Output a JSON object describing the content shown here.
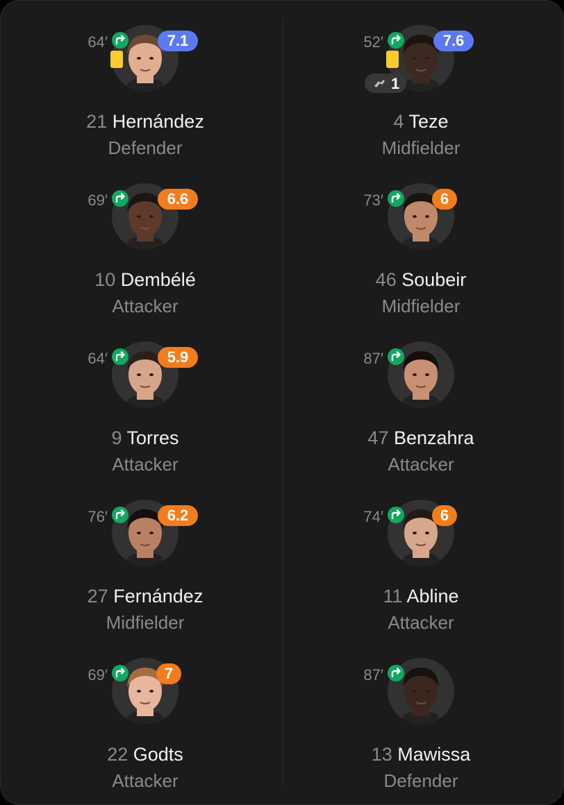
{
  "players": [
    {
      "minute": "64′",
      "rating": "7.1",
      "rating_color": "blue",
      "yellow_card": true,
      "number": "21",
      "name": "Hernández",
      "position": "Defender",
      "skin": "#e2ae92",
      "hair": "#6a4a33"
    },
    {
      "minute": "52′",
      "rating": "7.6",
      "rating_color": "blue",
      "yellow_card": true,
      "goals": "1",
      "number": "4",
      "name": "Teze",
      "position": "Midfielder",
      "skin": "#3c2a22",
      "hair": "#1b1410"
    },
    {
      "minute": "69′",
      "rating": "6.6",
      "rating_color": "orange",
      "number": "10",
      "name": "Dembélé",
      "position": "Attacker",
      "skin": "#5e3a2a",
      "hair": "#1d1612"
    },
    {
      "minute": "73′",
      "rating": "6",
      "rating_color": "orange",
      "number": "46",
      "name": "Soubeir",
      "position": "Midfielder",
      "skin": "#c08a6a",
      "hair": "#1a1410"
    },
    {
      "minute": "64′",
      "rating": "5.9",
      "rating_color": "orange",
      "number": "9",
      "name": "Torres",
      "position": "Attacker",
      "skin": "#d7a58a",
      "hair": "#2b2019"
    },
    {
      "minute": "87′",
      "number": "47",
      "name": "Benzahra",
      "position": "Attacker",
      "skin": "#c99073",
      "hair": "#140f0c"
    },
    {
      "minute": "76′",
      "rating": "6.2",
      "rating_color": "orange",
      "number": "27",
      "name": "Fernández",
      "position": "Midfielder",
      "skin": "#b98063",
      "hair": "#14100d"
    },
    {
      "minute": "74′",
      "rating": "6",
      "rating_color": "orange",
      "number": "11",
      "name": "Abline",
      "position": "Attacker",
      "skin": "#d8a68b",
      "hair": "#241a14"
    },
    {
      "minute": "69′",
      "rating": "7",
      "rating_color": "orange",
      "number": "22",
      "name": "Godts",
      "position": "Attacker",
      "skin": "#e8b69c",
      "hair": "#a56d3f"
    },
    {
      "minute": "87′",
      "number": "13",
      "name": "Mawissa",
      "position": "Defender",
      "skin": "#3b2720",
      "hair": "#171210"
    }
  ],
  "colors": {
    "blue": "#5b79f0",
    "orange": "#f37d1c",
    "sub": "#11a85f",
    "yellow_card": "#ffcb2e"
  }
}
